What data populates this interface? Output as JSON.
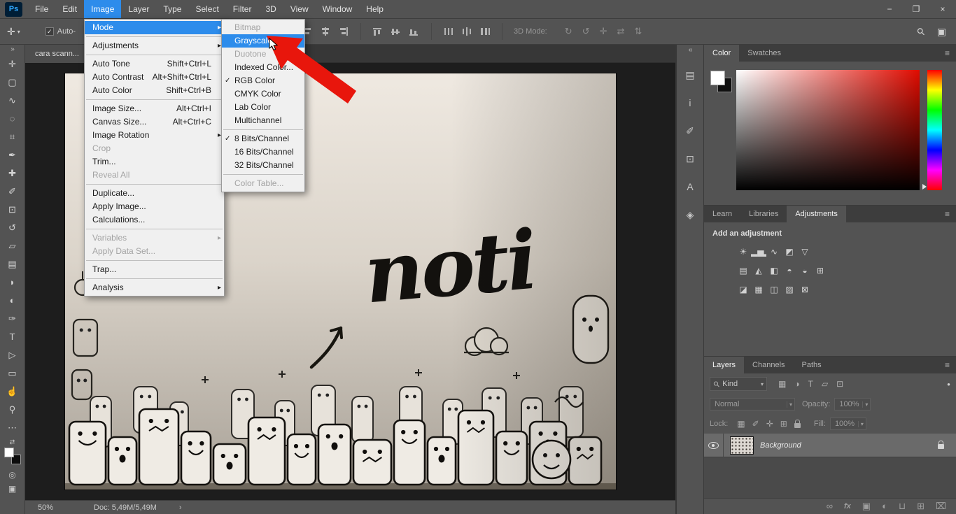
{
  "app": {
    "logo": "Ps",
    "window_controls": [
      {
        "name": "minimize-button",
        "glyph": "−"
      },
      {
        "name": "restore-button",
        "glyph": "❐"
      },
      {
        "name": "close-button",
        "glyph": "×"
      }
    ]
  },
  "menubar": {
    "items": [
      "File",
      "Edit",
      "Image",
      "Layer",
      "Type",
      "Select",
      "Filter",
      "3D",
      "View",
      "Window",
      "Help"
    ],
    "active_index": 2
  },
  "image_menu": {
    "items": [
      {
        "label": "Mode",
        "submenu": true,
        "highlight": true
      },
      {
        "type": "sep"
      },
      {
        "label": "Adjustments",
        "submenu": true
      },
      {
        "type": "sep"
      },
      {
        "label": "Auto Tone",
        "shortcut": "Shift+Ctrl+L"
      },
      {
        "label": "Auto Contrast",
        "shortcut": "Alt+Shift+Ctrl+L"
      },
      {
        "label": "Auto Color",
        "shortcut": "Shift+Ctrl+B"
      },
      {
        "type": "sep"
      },
      {
        "label": "Image Size...",
        "shortcut": "Alt+Ctrl+I"
      },
      {
        "label": "Canvas Size...",
        "shortcut": "Alt+Ctrl+C"
      },
      {
        "label": "Image Rotation",
        "submenu": true
      },
      {
        "label": "Crop",
        "disabled": true
      },
      {
        "label": "Trim..."
      },
      {
        "label": "Reveal All",
        "disabled": true
      },
      {
        "type": "sep"
      },
      {
        "label": "Duplicate..."
      },
      {
        "label": "Apply Image..."
      },
      {
        "label": "Calculations..."
      },
      {
        "type": "sep"
      },
      {
        "label": "Variables",
        "submenu": true,
        "disabled": true
      },
      {
        "label": "Apply Data Set...",
        "disabled": true
      },
      {
        "type": "sep"
      },
      {
        "label": "Trap..."
      },
      {
        "type": "sep"
      },
      {
        "label": "Analysis",
        "submenu": true
      }
    ]
  },
  "mode_submenu": {
    "items": [
      {
        "label": "Bitmap",
        "disabled": true
      },
      {
        "label": "Grayscale",
        "highlight": true
      },
      {
        "label": "Duotone",
        "disabled": true
      },
      {
        "label": "Indexed Color..."
      },
      {
        "label": "RGB Color",
        "checked": true
      },
      {
        "label": "CMYK Color"
      },
      {
        "label": "Lab Color"
      },
      {
        "label": "Multichannel"
      },
      {
        "type": "sep"
      },
      {
        "label": "8 Bits/Channel",
        "checked": true
      },
      {
        "label": "16 Bits/Channel"
      },
      {
        "label": "32 Bits/Channel"
      },
      {
        "type": "sep"
      },
      {
        "label": "Color Table...",
        "disabled": true
      }
    ]
  },
  "options_bar": {
    "move_tool_glyph": "✛",
    "caret_glyph": "▾",
    "check_glyph": "✓",
    "auto_label": "Auto-",
    "three_d_label": "3D Mode:",
    "align_icons": [
      {
        "name": "align-left-icon"
      },
      {
        "name": "align-center-h-icon"
      },
      {
        "name": "align-right-icon"
      },
      {
        "name": "align-top-icon"
      },
      {
        "name": "align-middle-icon"
      },
      {
        "name": "align-bottom-icon"
      },
      {
        "name": "distribute-left-icon"
      },
      {
        "name": "distribute-center-icon"
      },
      {
        "name": "distribute-right-icon"
      }
    ],
    "threed_icons": [
      {
        "name": "3d-orbit-icon",
        "glyph": "↻"
      },
      {
        "name": "3d-roll-icon",
        "glyph": "↺"
      },
      {
        "name": "3d-drag-icon",
        "glyph": "✛"
      },
      {
        "name": "3d-slide-icon",
        "glyph": "⇄"
      },
      {
        "name": "3d-scale-icon",
        "glyph": "⇅"
      }
    ],
    "right_icons": [
      {
        "name": "search-icon",
        "glyph": "⚲"
      },
      {
        "name": "workspace-icon",
        "glyph": "▣"
      }
    ]
  },
  "toolbar": {
    "collapse_glyph": "»",
    "swap_glyph": "⇄",
    "quick_mask_glyph": "◎",
    "screen_mode_glyph": "▣",
    "tools": [
      {
        "name": "move-tool",
        "glyph": "✛"
      },
      {
        "name": "marquee-tool",
        "glyph": "▢"
      },
      {
        "name": "lasso-tool",
        "glyph": "∿"
      },
      {
        "name": "quick-selection-tool",
        "glyph": "◌"
      },
      {
        "name": "crop-tool",
        "glyph": "⌗"
      },
      {
        "name": "eyedropper-tool",
        "glyph": "✒"
      },
      {
        "name": "healing-brush-tool",
        "glyph": "✚"
      },
      {
        "name": "brush-tool",
        "glyph": "✐"
      },
      {
        "name": "clone-stamp-tool",
        "glyph": "⊡"
      },
      {
        "name": "history-brush-tool",
        "glyph": "↺"
      },
      {
        "name": "eraser-tool",
        "glyph": "▱"
      },
      {
        "name": "gradient-tool",
        "glyph": "▤"
      },
      {
        "name": "blur-tool",
        "glyph": "◗"
      },
      {
        "name": "dodge-tool",
        "glyph": "◐"
      },
      {
        "name": "pen-tool",
        "glyph": "✑"
      },
      {
        "name": "type-tool",
        "glyph": "T"
      },
      {
        "name": "path-selection-tool",
        "glyph": "▷"
      },
      {
        "name": "shape-tool",
        "glyph": "▭"
      },
      {
        "name": "hand-tool",
        "glyph": "☝"
      },
      {
        "name": "zoom-tool",
        "glyph": "⚲"
      },
      {
        "name": "edit-toolbar-icon",
        "glyph": "⋯"
      }
    ]
  },
  "document": {
    "tab_title": "cara scann...",
    "canvas_word": "noti",
    "zoom_level": "50%",
    "doc_info": "Doc: 5,49M/5,49M",
    "chevron": "›"
  },
  "panel_strip": {
    "collapse_glyph": "«",
    "icons": [
      {
        "name": "properties-panel-icon",
        "glyph": "▤"
      },
      {
        "name": "info-panel-icon",
        "glyph": "i"
      },
      {
        "name": "brush-settings-panel-icon",
        "glyph": "✐"
      },
      {
        "name": "clone-source-panel-icon",
        "glyph": "⊡"
      },
      {
        "name": "character-panel-icon",
        "glyph": "A"
      },
      {
        "name": "3d-panel-icon",
        "glyph": "◈"
      }
    ]
  },
  "color_panel": {
    "tabs": [
      "Color",
      "Swatches"
    ],
    "active": "Color",
    "menu_glyph": "≡"
  },
  "adjustments_panel": {
    "tabs": [
      "Learn",
      "Libraries",
      "Adjustments"
    ],
    "active": "Adjustments",
    "menu_glyph": "≡",
    "header": "Add an adjustment",
    "rows": [
      [
        {
          "name": "brightness-contrast-icon",
          "glyph": "☀"
        },
        {
          "name": "levels-icon",
          "glyph": "▂▅▂"
        },
        {
          "name": "curves-icon",
          "glyph": "∿"
        },
        {
          "name": "exposure-icon",
          "glyph": "◩"
        },
        {
          "name": "vibrance-icon",
          "glyph": "▽"
        }
      ],
      [
        {
          "name": "hue-saturation-icon",
          "glyph": "▤"
        },
        {
          "name": "color-balance-icon",
          "glyph": "◭"
        },
        {
          "name": "black-white-icon",
          "glyph": "◧"
        },
        {
          "name": "photo-filter-icon",
          "glyph": "◓"
        },
        {
          "name": "channel-mixer-icon",
          "glyph": "◒"
        },
        {
          "name": "color-lookup-icon",
          "glyph": "⊞"
        }
      ],
      [
        {
          "name": "invert-icon",
          "glyph": "◪"
        },
        {
          "name": "posterize-icon",
          "glyph": "▦"
        },
        {
          "name": "threshold-icon",
          "glyph": "◫"
        },
        {
          "name": "gradient-map-icon",
          "glyph": "▨"
        },
        {
          "name": "selective-color-icon",
          "glyph": "⊠"
        }
      ]
    ]
  },
  "layers_panel": {
    "tabs": [
      "Layers",
      "Channels",
      "Paths"
    ],
    "active": "Layers",
    "menu_glyph": "≡",
    "search_glyph": "⚲",
    "kind_label": "Kind",
    "caret": "▾",
    "filter_icons": [
      {
        "name": "filter-pixel-icon",
        "glyph": "▦"
      },
      {
        "name": "filter-adjustment-icon",
        "glyph": "◑"
      },
      {
        "name": "filter-type-icon",
        "glyph": "T"
      },
      {
        "name": "filter-shape-icon",
        "glyph": "▱"
      },
      {
        "name": "filter-smart-object-icon",
        "glyph": "⊡"
      }
    ],
    "filter_toggle_glyph": "●",
    "blend_mode": "Normal",
    "opacity_label": "Opacity:",
    "opacity_value": "100%",
    "lock_label": "Lock:",
    "lock_icons": [
      {
        "name": "lock-transparent-pixels-icon",
        "glyph": "▦"
      },
      {
        "name": "lock-image-pixels-icon",
        "glyph": "✐"
      },
      {
        "name": "lock-position-icon",
        "glyph": "✛"
      },
      {
        "name": "lock-nesting-icon",
        "glyph": "⊞"
      },
      {
        "name": "lock-all-icon",
        "css": "padlock"
      }
    ],
    "fill_label": "Fill:",
    "fill_value": "100%",
    "layer": {
      "name": "Background",
      "locked": true,
      "visible": true
    },
    "bottom_icons": [
      {
        "name": "link-layers-icon",
        "glyph": "∞"
      },
      {
        "name": "layer-effects-icon",
        "glyph": "fx"
      },
      {
        "name": "layer-mask-icon",
        "glyph": "▣"
      },
      {
        "name": "adjustment-layer-icon",
        "glyph": "◐"
      },
      {
        "name": "layer-group-icon",
        "glyph": "⊔"
      },
      {
        "name": "new-layer-icon",
        "glyph": "⊞"
      },
      {
        "name": "delete-layer-icon",
        "glyph": "⌧"
      }
    ]
  },
  "colors": {
    "accent_blue": "#2d8ceb",
    "panel_bg": "#535353",
    "menu_bg": "#f0f0f0",
    "canvas_bg": "#1d1d1d",
    "arrow_red": "#e8160c"
  }
}
